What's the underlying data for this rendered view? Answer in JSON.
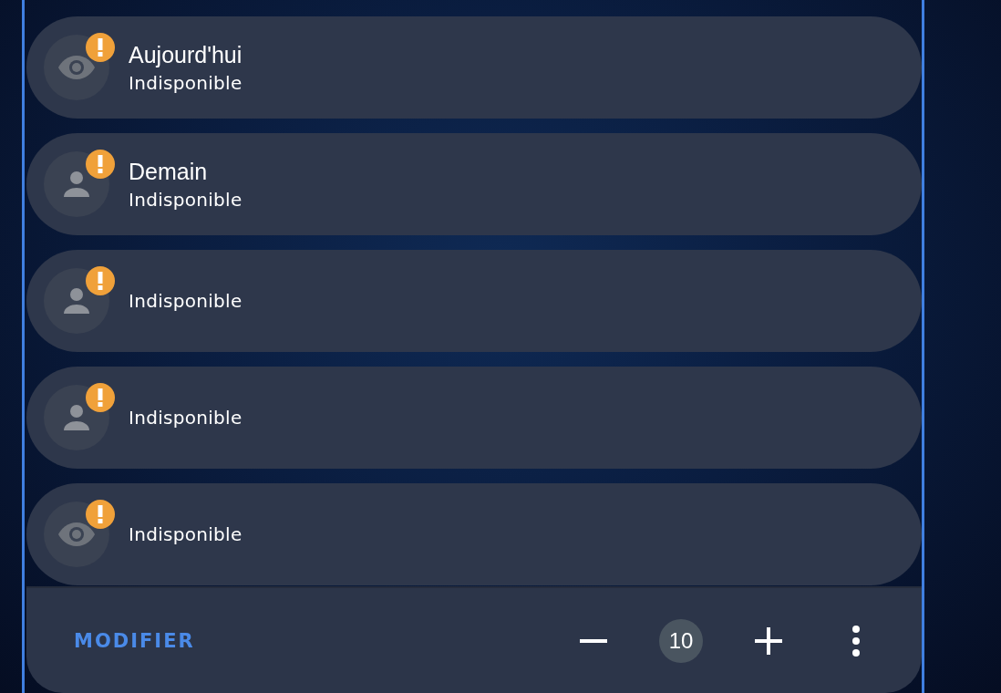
{
  "entities": [
    {
      "kind": "eye",
      "title": "Aujourd'hui",
      "state": "Indisponible",
      "warning": true
    },
    {
      "kind": "person",
      "title": "Demain",
      "state": "Indisponible",
      "warning": true
    },
    {
      "kind": "person",
      "state": "Indisponible",
      "warning": true
    },
    {
      "kind": "person",
      "state": "Indisponible",
      "warning": true
    },
    {
      "kind": "eye",
      "state": "Indisponible",
      "warning": true
    }
  ],
  "footer": {
    "edit_label": "MODIFIER",
    "count": "10"
  }
}
